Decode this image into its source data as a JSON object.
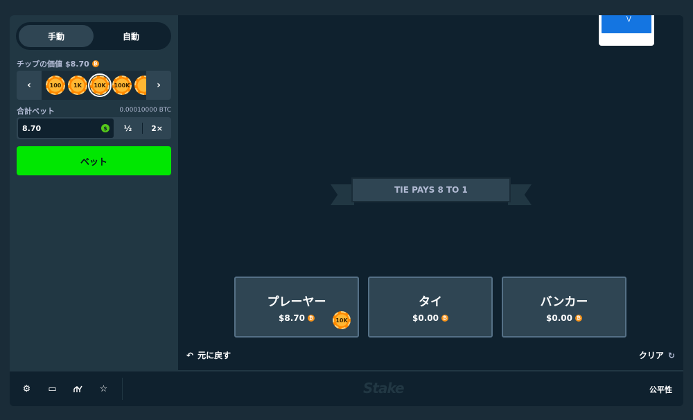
{
  "mode_toggle": {
    "manual": "手動",
    "auto": "自動"
  },
  "chip_value": {
    "label": "チップの価値",
    "amount": "$8.70",
    "currency_icon": "bitcoin-icon"
  },
  "chips": [
    "100",
    "1K",
    "10K",
    "100K",
    ""
  ],
  "selected_chip": "10K",
  "total_bet": {
    "label": "合計ベット",
    "btc_value": "0.00010000 BTC",
    "amount": "8.70",
    "half": "½",
    "double": "2×"
  },
  "bet_button": "ベット",
  "banner": "TIE PAYS 8 TO 1",
  "bets": [
    {
      "title": "プレーヤー",
      "amount": "$8.70",
      "chip": "10K"
    },
    {
      "title": "タイ",
      "amount": "$0.00"
    },
    {
      "title": "バンカー",
      "amount": "$0.00"
    }
  ],
  "controls": {
    "undo": "元に戻す",
    "clear": "クリア"
  },
  "footer": {
    "logo": "Stake",
    "fairness": "公平性"
  },
  "colors": {
    "bet_green": "#00e701",
    "chip_orange": "#ff8a00",
    "card_blue": "#1475e1"
  }
}
